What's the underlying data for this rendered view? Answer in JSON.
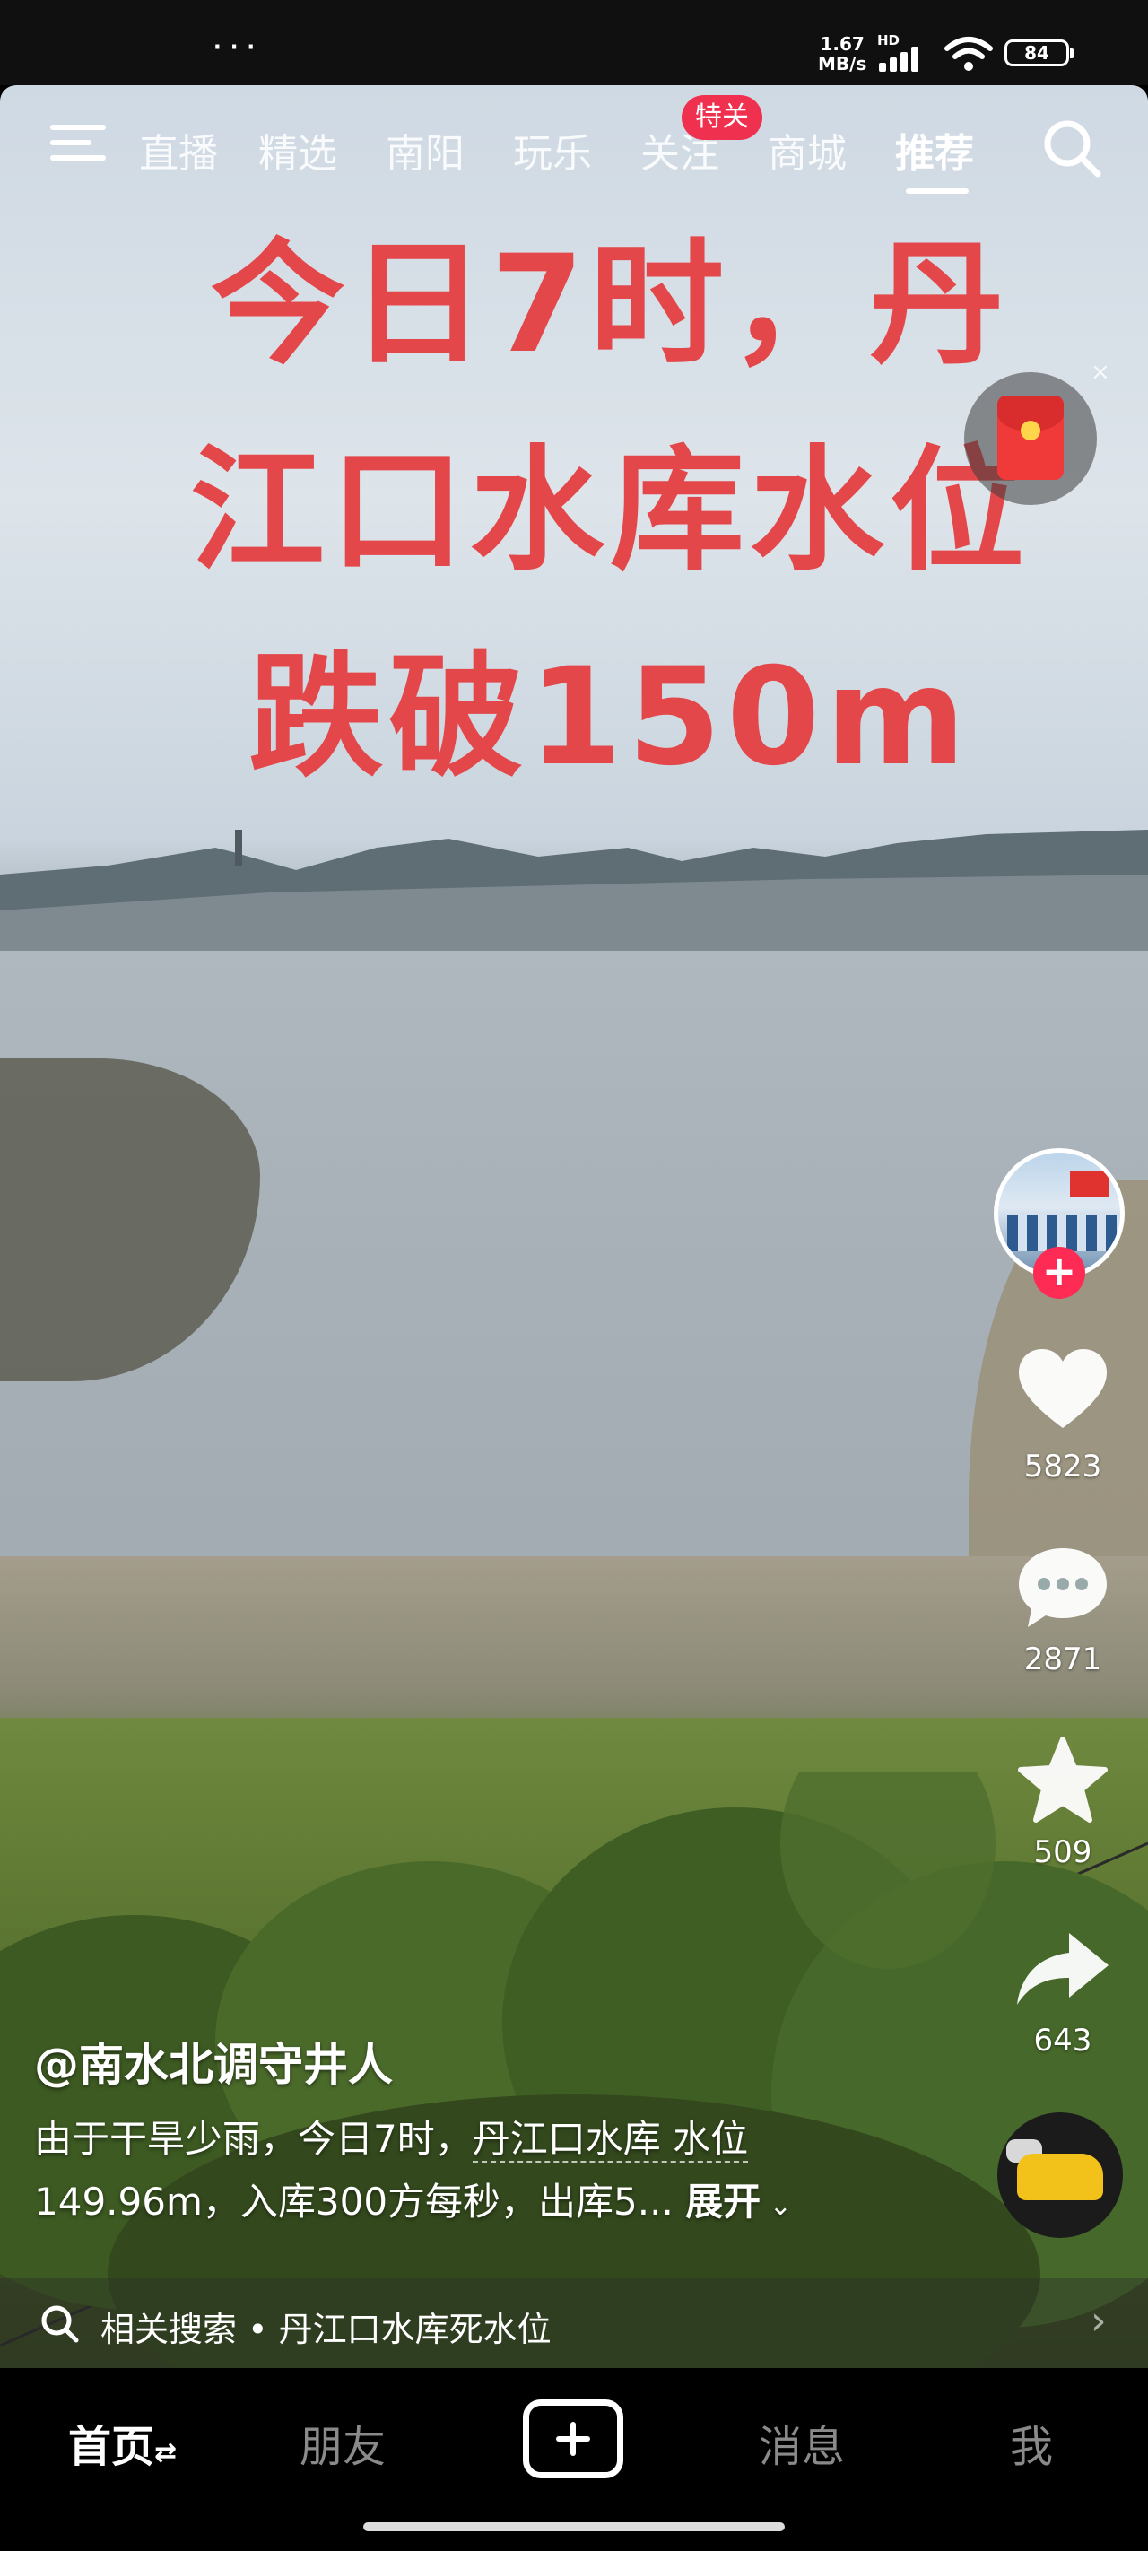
{
  "status_bar": {
    "menu_dots": "···",
    "net_speed_value": "1.67",
    "net_speed_unit": "MB/s",
    "hd": "HD",
    "battery": "84"
  },
  "top_nav": {
    "tabs": [
      {
        "label": "直播",
        "active": false
      },
      {
        "label": "精选",
        "active": false
      },
      {
        "label": "南阳",
        "active": false
      },
      {
        "label": "玩乐",
        "active": false
      },
      {
        "label": "关注",
        "active": false
      },
      {
        "label": "商城",
        "active": false
      },
      {
        "label": "推荐",
        "active": true
      }
    ],
    "follow_badge": "特关"
  },
  "video": {
    "overlay_lines": [
      "今日7时，丹",
      "江口水库水位",
      "跌破150m"
    ]
  },
  "actions": {
    "likes": "5823",
    "comments": "2871",
    "favorites": "509",
    "shares": "643",
    "follow_plus": "+",
    "red_packet_close": "×"
  },
  "caption": {
    "author": "@南水北调守井人",
    "desc_part1": "由于干旱少雨，今日7时，",
    "desc_link": "丹江口水库 水位",
    "desc_part2": "149.96m，入库300方每秒，出库5...",
    "expand": "展开"
  },
  "related_search": {
    "text": "相关搜索 • 丹江口水库死水位",
    "arrow": "›"
  },
  "bottom_nav": {
    "home": "首页",
    "home_switch": "⇄",
    "friends": "朋友",
    "messages": "消息",
    "me": "我"
  }
}
